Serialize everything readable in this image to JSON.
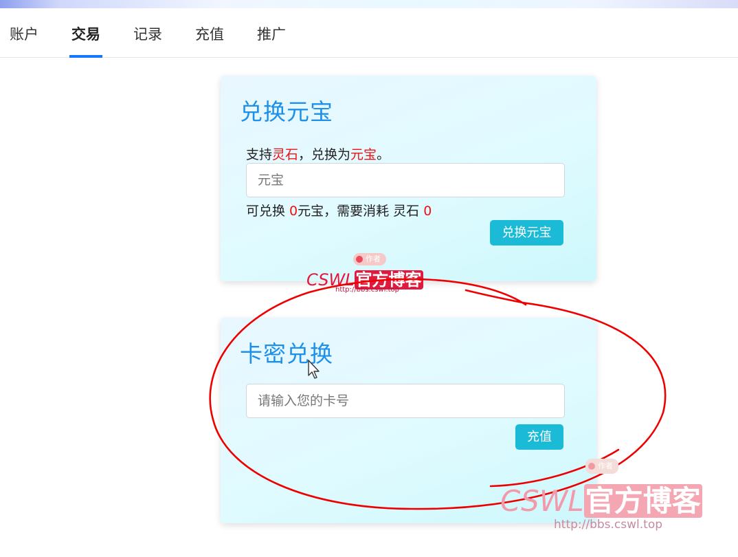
{
  "nav": {
    "tabs": [
      {
        "label": "账户"
      },
      {
        "label": "交易"
      },
      {
        "label": "记录"
      },
      {
        "label": "充值"
      },
      {
        "label": "推广"
      }
    ],
    "active_index": 1
  },
  "exchange_card": {
    "title": "兑换元宝",
    "desc_prefix": "支持",
    "desc_item1": "灵石",
    "desc_middle": "，兑换为",
    "desc_item2": "元宝",
    "desc_suffix": "。",
    "input_placeholder": "元宝",
    "info_prefix": "可兑换 ",
    "info_amount": "0",
    "info_middle": "元宝，需要消耗 灵石 ",
    "info_cost": "0",
    "button_label": "兑换元宝"
  },
  "card_redeem_card": {
    "title": "卡密兑换",
    "input_placeholder": "请输入您的卡号",
    "button_label": "充值"
  },
  "watermark": {
    "badge": "作者",
    "latin": "CSWL",
    "cjk": "官方博客",
    "url": "http://bbs.cswl.top"
  },
  "colors": {
    "accent_blue": "#1677ff",
    "title_blue": "#1e90e8",
    "highlight_red": "#f01010",
    "button_cyan": "#1bbbd8",
    "annotation_red": "#ee0000"
  }
}
